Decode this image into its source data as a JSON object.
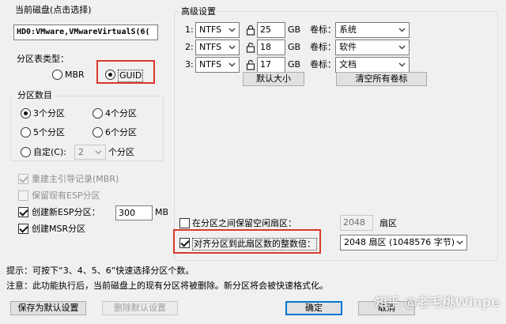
{
  "current_disk": {
    "title": "当前磁盘(点击选择)",
    "value": "HD0:VMware,VMwareVirtualS(6("
  },
  "partition_type": {
    "title": "分区表类型：",
    "options": [
      {
        "label": "MBR",
        "checked": false
      },
      {
        "label": "GUID",
        "checked": true
      }
    ]
  },
  "partition_count": {
    "title": "分区数目",
    "options": [
      {
        "label": "3个分区",
        "checked": true
      },
      {
        "label": "4个分区",
        "checked": false
      },
      {
        "label": "5个分区",
        "checked": false
      },
      {
        "label": "6个分区",
        "checked": false
      }
    ],
    "custom_label": "自定(C):",
    "custom_value": "2",
    "custom_suffix": "个分区"
  },
  "options": {
    "rebuild_mbr": {
      "label": "重建主引导记录(MBR)",
      "checked": true,
      "disabled": true
    },
    "keep_esp": {
      "label": "保留现有ESP分区",
      "checked": false,
      "disabled": true
    },
    "create_esp": {
      "label": "创建新ESP分区：",
      "checked": true,
      "size": "300",
      "unit": "MB"
    },
    "create_msr": {
      "label": "创建MSR分区",
      "checked": true
    }
  },
  "advanced": {
    "title": "高级设置",
    "rows": [
      {
        "num": "1:",
        "fs": "NTFS",
        "size": "25",
        "unit": "GB",
        "vol_label": "卷标：",
        "volume": "系统"
      },
      {
        "num": "2:",
        "fs": "NTFS",
        "size": "18",
        "unit": "GB",
        "vol_label": "卷标：",
        "volume": "软件"
      },
      {
        "num": "3:",
        "fs": "NTFS",
        "size": "17",
        "unit": "GB",
        "vol_label": "卷标：",
        "volume": "文档"
      }
    ],
    "default_size_btn": "默认大小",
    "clear_labels_btn": "清空所有卷标",
    "reserve_gap": {
      "label": "在分区之间保留空闲扇区：",
      "checked": false,
      "value": "2048",
      "unit": "扇区"
    },
    "align": {
      "label": "对齐分区到此扇区数的整数倍：",
      "checked": true,
      "value": "2048 扇区 (1048576 字节)"
    }
  },
  "hints": {
    "tip": "提示：可按下“3、4、5、6”快速选择分区个数。",
    "note": "注意：此功能执行后，当前磁盘上的现有分区将被删除。新分区将会被快速格式化。"
  },
  "buttons": {
    "save_default": "保存为默认设置",
    "delete_default": "删除默认设置",
    "ok": "确定",
    "cancel": "取消"
  },
  "watermark": "知乎 @老毛桃Winpe",
  "colors": {
    "highlight_red": "#d9392b",
    "focus_blue": "#0078d7"
  }
}
